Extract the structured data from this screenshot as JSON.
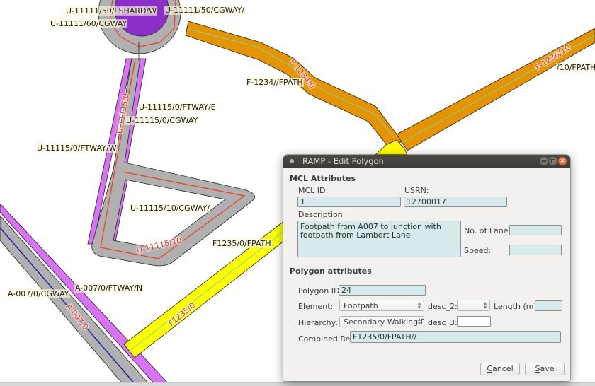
{
  "map": {
    "labels": {
      "u11111_50_lshard_w": "U-11111/50/LSHARD/W",
      "u11111_50_cgway": "U-11111/50/CGWAY/",
      "u11111_60_cgway": "U-11111/60/CGWAY",
      "f1234_fpath": "F-1234//FPATH",
      "f1236_fpath": "/10/FPATH",
      "u11115_0_ftway_e": "U-11115/0/FTWAY/E",
      "u11115_0_cgway": "U-11115/0/CGWAY",
      "u11115_0_ftway_w": "U-11115/0/FTWAY/W",
      "u11115_10_cgway": "U-11115/10/CGWAY/",
      "f1235_0_fpath": "F1235/0/FPATH",
      "a007_0_ftway_n": "A-007/0/FTWAY/N",
      "a007_0_cgway": "A-007/0/CGWAY"
    },
    "segment_labels": {
      "f1234_0": "F-1234/0",
      "f1236_10": "F-1236/10",
      "u11115_0": "U-11115/0",
      "u11115_10": "U-11115/10",
      "f1235_0": "F1235/0",
      "a007_0": "A-007/0"
    },
    "colors": {
      "carriageway": "#b0b0b0",
      "footway": "#d973f5",
      "roundabout_center": "#8b2fc9",
      "footpath_orange": "#e39400",
      "footpath_selected": "#ffff00",
      "centerline_red": "#f03c14",
      "centerline_green": "#7fd4a0",
      "centerline_blue": "#1a1aa0"
    }
  },
  "dialog": {
    "title": "RAMP - Edit Polygon",
    "mcl_section": {
      "heading": "MCL Attributes",
      "mcl_id_label": "MCL ID:",
      "mcl_id_value": "1",
      "usrn_label": "USRN:",
      "usrn_value": "12700017",
      "description_label": "Description:",
      "description_value": "Footpath from A007 to junction with footpath from Lambert Lane",
      "lanes_label": "No. of Lanes:",
      "lanes_value": "",
      "speed_label": "Speed:",
      "speed_value": ""
    },
    "polygon_section": {
      "heading": "Polygon attributes",
      "polygon_id_label": "Polygon ID:",
      "polygon_id_value": "24",
      "element_label": "Element:",
      "element_value": "Footpath",
      "desc2_label": "desc_2:",
      "desc2_value": "",
      "length_label": "Length (m):",
      "length_value": "",
      "hierarchy_label": "Hierarchy:",
      "hierarchy_value": "Secondary Walking Ro",
      "desc3_label": "desc_3:",
      "desc3_value": "",
      "combined_ref_label": "Combined Ref:",
      "combined_ref_value": "F1235/0/FPATH//"
    },
    "buttons": {
      "cancel_mnemonic": "C",
      "cancel_rest": "ancel",
      "save_mnemonic": "S",
      "save_rest": "ave"
    }
  }
}
